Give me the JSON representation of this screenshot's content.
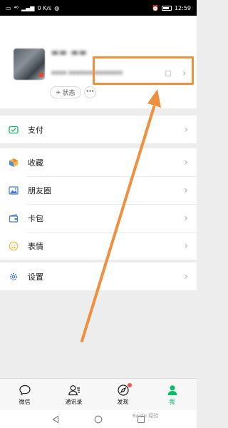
{
  "status_bar": {
    "signal": "⁴⁶",
    "speed": "0 K/s",
    "time": "12:59"
  },
  "profile": {
    "nickname": "▬▬ ▬▬",
    "wechat_id": "▪▪▪▪ ▪▪▪▪▪▪▪▪▪▪▪▪▪▪",
    "chevron": "›",
    "status_plus": "+",
    "status_label": "状态",
    "more_label": "···"
  },
  "menu": {
    "pay": "支付",
    "favorites": "收藏",
    "moments": "朋友圈",
    "cards": "卡包",
    "stickers": "表情",
    "settings": "设置",
    "chevron": "›"
  },
  "tabs": {
    "chats": "微信",
    "contacts": "通讯录",
    "discover": "发现",
    "me": "我"
  },
  "annotation": {
    "color": "#f08f3e"
  },
  "colors": {
    "accent": "#07c160",
    "badge": "#fa5151"
  },
  "icons": [
    "signal-icon",
    "wifi-icon",
    "alarm-icon",
    "battery-icon",
    "qr-code-icon",
    "chevron-right-icon",
    "pay-icon",
    "favorites-icon",
    "moments-icon",
    "cards-icon",
    "stickers-icon",
    "settings-icon",
    "chat-icon",
    "contacts-icon",
    "compass-icon",
    "person-icon",
    "back-icon",
    "home-icon",
    "recents-icon"
  ],
  "watermark": "Baidu 经验"
}
